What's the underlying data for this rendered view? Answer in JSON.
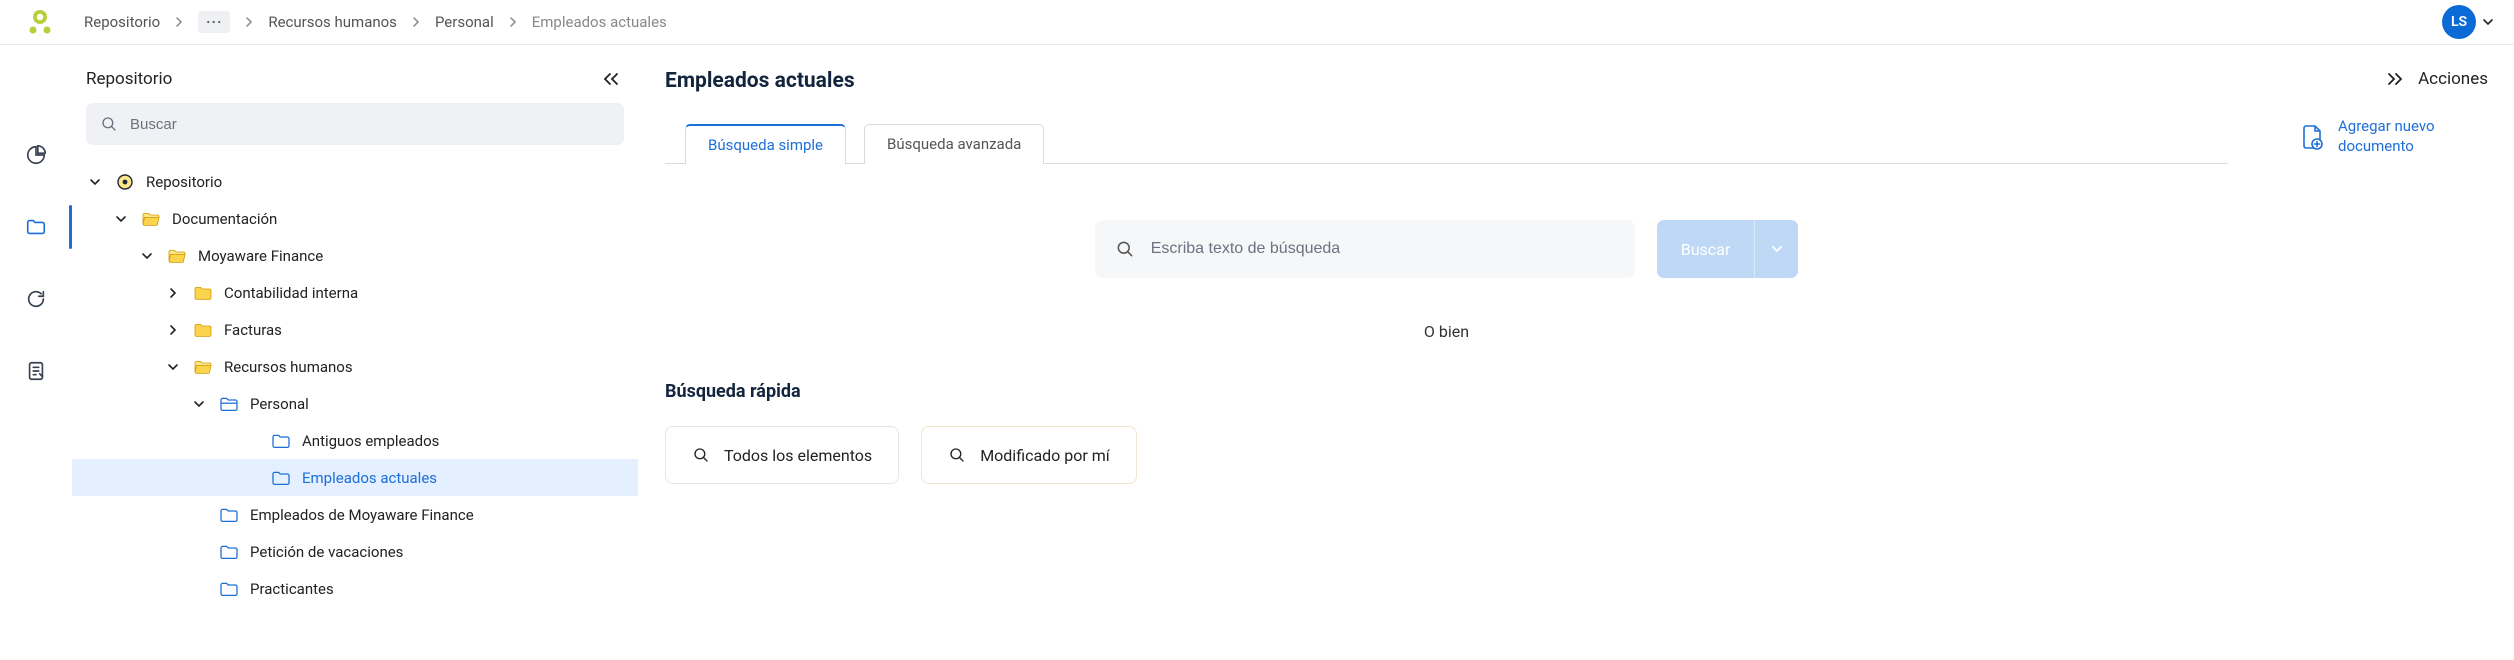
{
  "breadcrumb": {
    "root": "Repositorio",
    "ellipsis": "···",
    "item2": "Recursos humanos",
    "item3": "Personal",
    "current": "Empleados actuales"
  },
  "user": {
    "initials": "LS"
  },
  "sidebar": {
    "title": "Repositorio",
    "search_placeholder": "Buscar",
    "tree": {
      "root": "Repositorio",
      "doc": "Documentación",
      "company": "Moyaware Finance",
      "cont": "Contabilidad interna",
      "fact": "Facturas",
      "rh": "Recursos humanos",
      "pers": "Personal",
      "ant": "Antiguos empleados",
      "act": "Empleados actuales",
      "empdm": "Empleados de Moyaware Finance",
      "vac": "Petición de vacaciones",
      "prac": "Practicantes"
    }
  },
  "page": {
    "title": "Empleados actuales",
    "tab_simple": "Búsqueda simple",
    "tab_advanced": "Búsqueda avanzada",
    "search_placeholder": "Escriba texto de búsqueda",
    "search_btn": "Buscar",
    "or": "O bien",
    "quick_title": "Búsqueda rápida",
    "chip_all": "Todos los elementos",
    "chip_mine": "Modificado por mí"
  },
  "actions": {
    "title": "Acciones",
    "add_doc": "Agregar nuevo documento"
  }
}
